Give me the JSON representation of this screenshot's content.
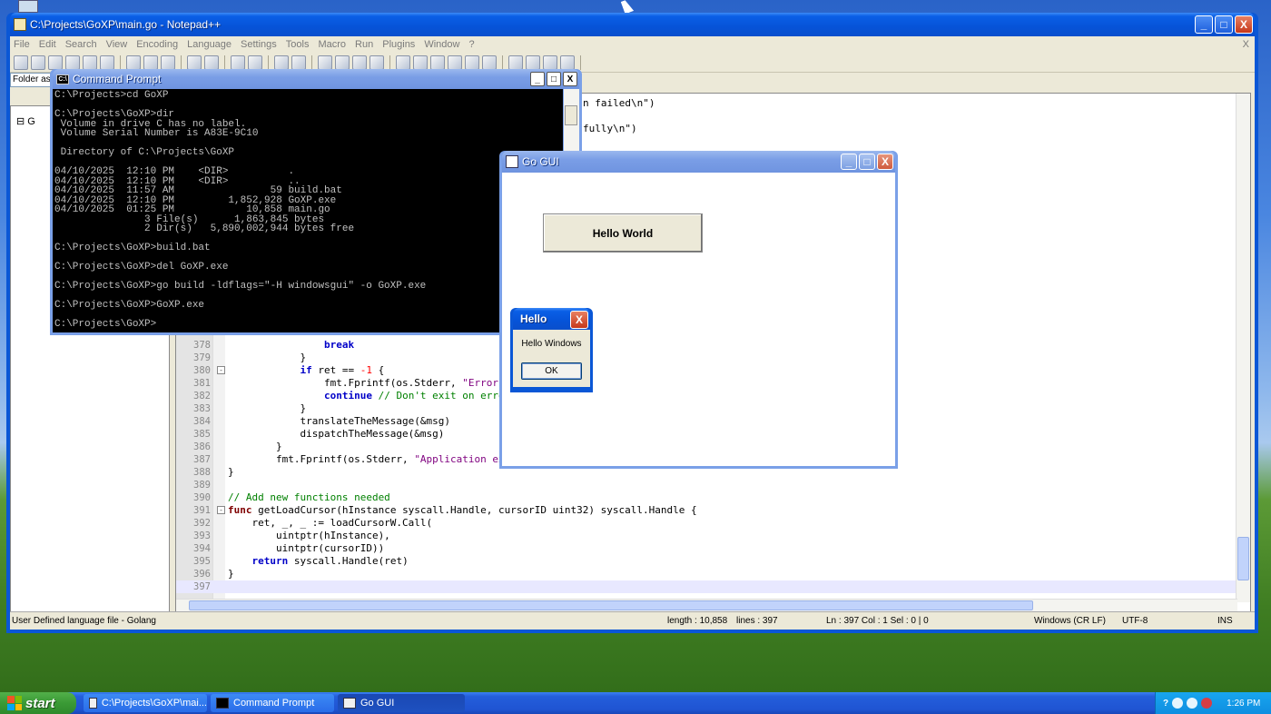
{
  "npp": {
    "title": "C:\\Projects\\GoXP\\main.go - Notepad++",
    "menu": [
      "File",
      "Edit",
      "Search",
      "View",
      "Encoding",
      "Language",
      "Settings",
      "Tools",
      "Macro",
      "Run",
      "Plugins",
      "Window",
      "?"
    ],
    "menu_close": "X",
    "folder_label": "Folder as W",
    "tree_root": "G",
    "code_lines": [
      {
        "n": "378",
        "html": "                <span class=\"kw\">break</span>"
      },
      {
        "n": "379",
        "html": "            }"
      },
      {
        "n": "380",
        "html": "            <span class=\"kw\">if</span> ret == <span class=\"num\">-1</span> {"
      },
      {
        "n": "381",
        "html": "                fmt.Fprintf(os.Stderr, <span class=\"strv\">\"Error i</span>"
      },
      {
        "n": "382",
        "html": "                <span class=\"kw\">continue</span> <span class=\"cmt\">// Don't exit on error</span>"
      },
      {
        "n": "383",
        "html": "            }"
      },
      {
        "n": "384",
        "html": "            translateTheMessage(&amp;msg)"
      },
      {
        "n": "385",
        "html": "            dispatchTheMessage(&amp;msg)"
      },
      {
        "n": "386",
        "html": "        }"
      },
      {
        "n": "387",
        "html": "        fmt.Fprintf(os.Stderr, <span class=\"strv\">\"Application exi</span>"
      },
      {
        "n": "388",
        "html": "}"
      },
      {
        "n": "389",
        "html": ""
      },
      {
        "n": "390",
        "html": "<span class=\"cmt\">// Add new functions needed</span>"
      },
      {
        "n": "391",
        "html": "<span class=\"kw\" style=\"color:#7f0000\">func</span> getLoadCursor(hInstance syscall.Handle, cursorID uint32) syscall.Handle {"
      },
      {
        "n": "392",
        "html": "    ret, _, _ := loadCursorW.Call("
      },
      {
        "n": "393",
        "html": "        uintptr(hInstance),"
      },
      {
        "n": "394",
        "html": "        uintptr(cursorID))"
      },
      {
        "n": "395",
        "html": "    <span class=\"kw\">return</span> syscall.Handle(ret)"
      },
      {
        "n": "396",
        "html": "}"
      },
      {
        "n": "397",
        "html": ""
      }
    ],
    "top_fragment_1": "n failed\\n\")",
    "top_fragment_2": "fully\\n\")",
    "status": {
      "lang": "User Defined language file - Golang",
      "length": "length : 10,858",
      "lines": "lines : 397",
      "pos": "Ln : 397    Col : 1    Sel : 0 | 0",
      "eol": "Windows (CR LF)",
      "enc": "UTF-8",
      "mode": "INS"
    }
  },
  "cmd": {
    "title": "Command Prompt",
    "icon_text": "C:\\",
    "output": "C:\\Projects>cd GoXP\n\nC:\\Projects\\GoXP>dir\n Volume in drive C has no label.\n Volume Serial Number is A83E-9C10\n\n Directory of C:\\Projects\\GoXP\n\n04/10/2025  12:10 PM    <DIR>          .\n04/10/2025  12:10 PM    <DIR>          ..\n04/10/2025  11:57 AM                59 build.bat\n04/10/2025  12:10 PM         1,852,928 GoXP.exe\n04/10/2025  01:25 PM            10,858 main.go\n               3 File(s)      1,863,845 bytes\n               2 Dir(s)   5,890,002,944 bytes free\n\nC:\\Projects\\GoXP>build.bat\n\nC:\\Projects\\GoXP>del GoXP.exe\n\nC:\\Projects\\GoXP>go build -ldflags=\"-H windowsgui\" -o GoXP.exe\n\nC:\\Projects\\GoXP>GoXP.exe\n\nC:\\Projects\\GoXP>"
  },
  "gogui": {
    "title": "Go GUI",
    "button": "Hello World"
  },
  "dialog": {
    "title": "Hello",
    "message": "Hello Windows",
    "ok": "OK"
  },
  "window_controls": {
    "min": "_",
    "max": "□",
    "close": "X"
  },
  "taskbar": {
    "start": "start",
    "items": [
      "C:\\Projects\\GoXP\\mai...",
      "Command Prompt",
      "Go GUI"
    ],
    "clock": "1:26 PM",
    "help": "?"
  }
}
